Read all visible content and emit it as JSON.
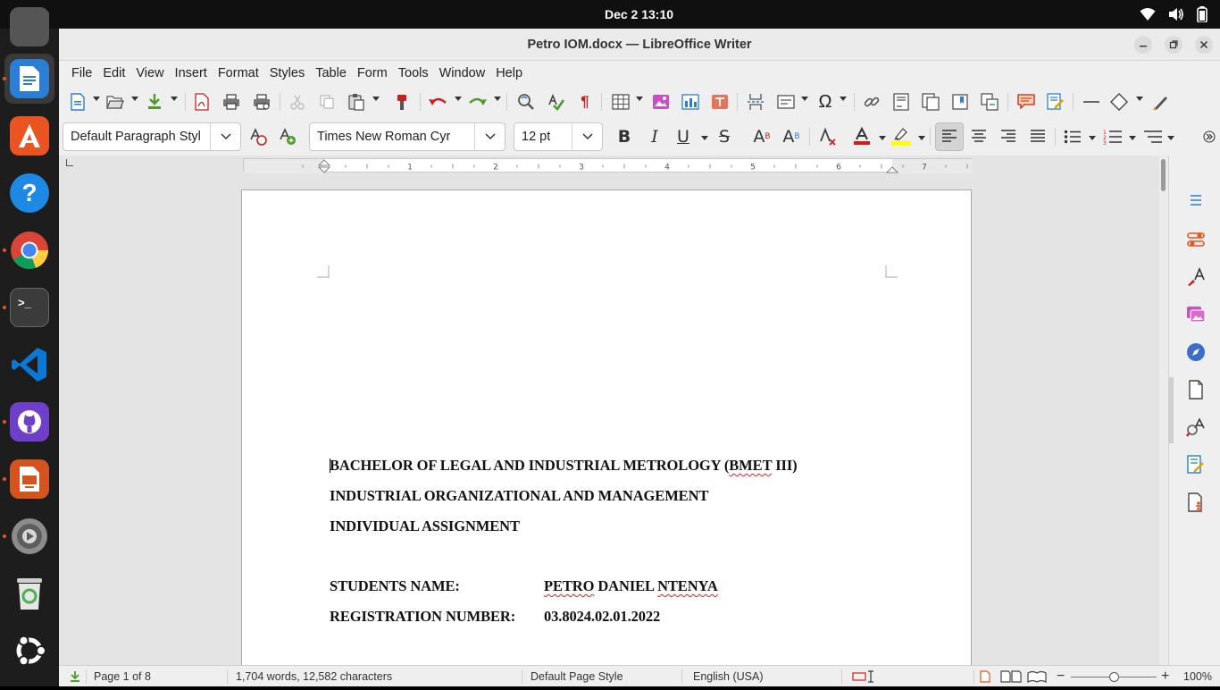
{
  "topbar": {
    "clock": "Dec 2  13:10",
    "tray_icons": [
      "wifi-icon",
      "volume-icon",
      "battery-icon"
    ]
  },
  "dock": {
    "apps": [
      "libreoffice-writer",
      "app-center",
      "help",
      "google-chrome",
      "terminal",
      "vscode",
      "github-desktop",
      "libreoffice-impress",
      "settings",
      "trash",
      "show-apps"
    ]
  },
  "window": {
    "title": "Petro IOM.docx — LibreOffice Writer"
  },
  "menubar": {
    "items": [
      "File",
      "Edit",
      "View",
      "Insert",
      "Format",
      "Styles",
      "Table",
      "Form",
      "Tools",
      "Window",
      "Help"
    ]
  },
  "formatting": {
    "paragraph_style": "Default Paragraph Styl",
    "font_name": "Times New Roman Cyr",
    "font_size": "12 pt",
    "bold": "B",
    "italic": "I",
    "underline": "U",
    "strike": "S",
    "superscript": "A",
    "subscript": "A",
    "font_color": "#c9211e",
    "highlight_color": "#ffff00",
    "alignment": "left"
  },
  "document": {
    "lines": [
      "BACHELOR OF LEGAL AND INDUSTRIAL METROLOGY (BMET III)",
      "INDUSTRIAL ORGANIZATIONAL AND MANAGEMENT",
      "INDIVIDUAL ASSIGNMENT"
    ],
    "line1_prefix": "BACHELOR OF LEGAL AND INDUSTRIAL METROLOGY (",
    "line1_misspelled": "BMET",
    "line1_suffix": " III)",
    "fields": [
      {
        "label": "STUDENTS NAME:",
        "value_word1": "PETRO",
        "value_word2": " DANIEL ",
        "value_word3": "NTENYA"
      },
      {
        "label": "REGISTRATION NUMBER:",
        "value": "03.8024.02.01.2022"
      }
    ]
  },
  "statusbar": {
    "page": "Page 1 of 8",
    "words": "1,704 words, 12,582 characters",
    "page_style": "Default Page Style",
    "language": "English (USA)",
    "zoom": "100%"
  },
  "ruler": {
    "numbers": [
      "1",
      "2",
      "3",
      "4",
      "5",
      "6",
      "7"
    ]
  }
}
